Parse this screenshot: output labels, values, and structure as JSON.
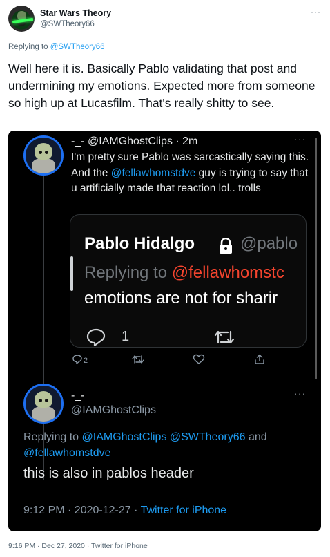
{
  "author": {
    "name": "Star Wars Theory",
    "handle": "@SWTheory66",
    "more": "···"
  },
  "replying": {
    "prefix": "Replying to ",
    "mention": "@SWTheory66"
  },
  "tweet_text": "Well here it is. Basically Pablo validating that post and undermining my emotions. Expected more from someone so high up at Lucasfilm. That's really shitty to see.",
  "screenshot": {
    "quoted": {
      "name_line": "-_- @IAMGhostClips · 2m",
      "more": "···",
      "text_before": "I'm pretty sure Pablo was sarcastically saying this. And the ",
      "mention": "@fellawhomstdve",
      "text_after": " guy is trying to say that u artificially made that reaction lol.. trolls",
      "inner": {
        "name": "Pablo Hidalgo",
        "handle": "@pablo",
        "reply_prefix": "Replying to ",
        "reply_mention": "@fellawhomstc",
        "text": "emotions are not for sharir",
        "reply_count": "1"
      },
      "reply_count": "2"
    },
    "reply": {
      "name": "-_-",
      "handle": "@IAMGhostClips",
      "more": "···",
      "replying_prefix": "Replying to ",
      "replying_mentions": "@IAMGhostClips @SWTheory66",
      "replying_and": " and",
      "replying_mention2": "@fellawhomstdve",
      "text": "this is also in pablos header",
      "time_date": "9:12 PM · 2020-12-27 · ",
      "source": "Twitter for iPhone"
    }
  },
  "footer": "9:16 PM · Dec 27, 2020 · Twitter for iPhone",
  "colors": {
    "link": "#1d9bf0",
    "inner_mention": "#f4442e",
    "screenshot_bg": "#000000",
    "avatar_ring": "#1d6ff2"
  }
}
